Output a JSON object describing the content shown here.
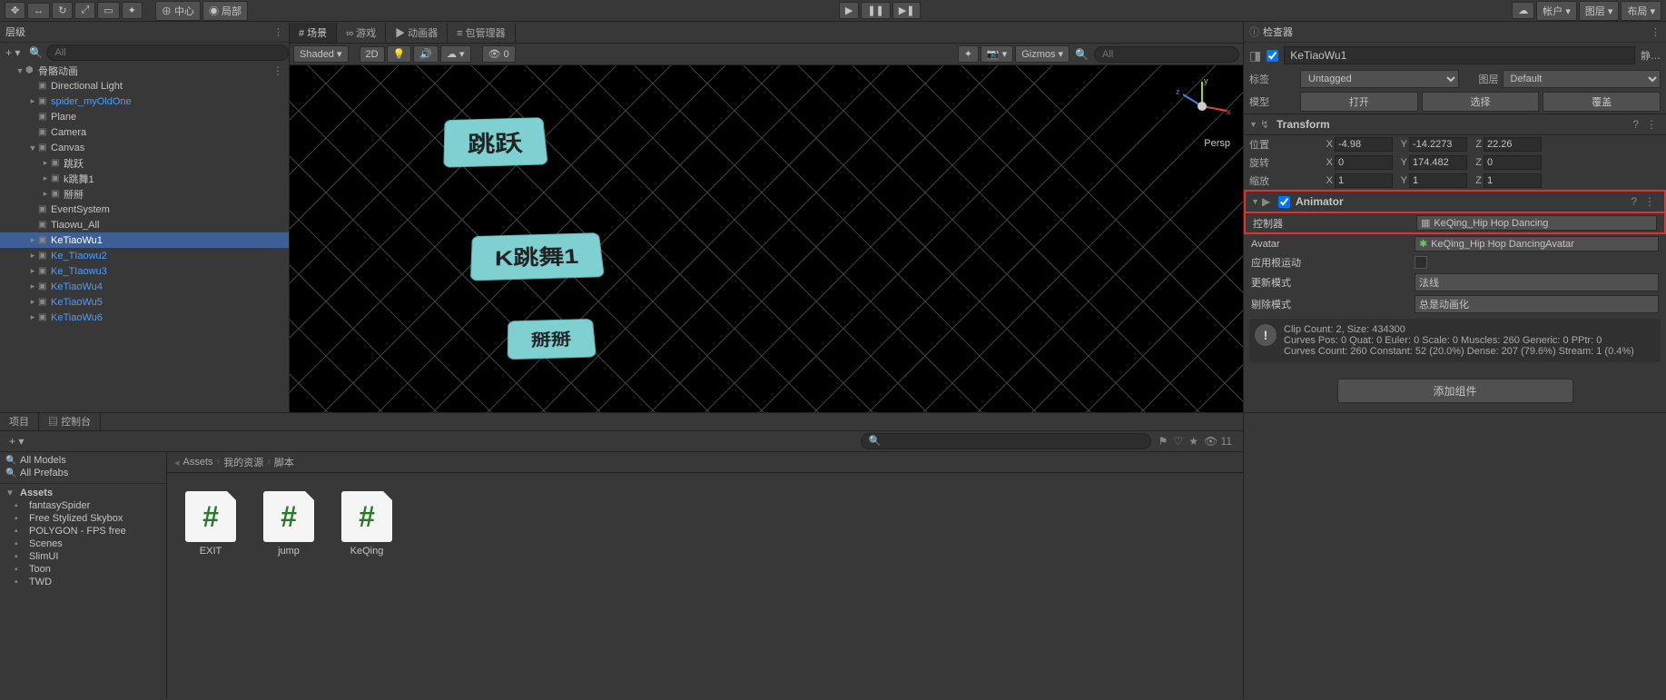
{
  "topbar": {
    "center": "中心",
    "local": "局部",
    "account": "帐户",
    "layers": "图层",
    "layout": "布局"
  },
  "hierarchy": {
    "label": "层级",
    "search_placeholder": "All",
    "root": "骨骼动画",
    "nodes": [
      {
        "name": "Directional Light",
        "blue": false,
        "ind": 2
      },
      {
        "name": "spider_myOldOne",
        "blue": true,
        "ind": 2,
        "arrow": true
      },
      {
        "name": "Plane",
        "blue": false,
        "ind": 2
      },
      {
        "name": "Camera",
        "blue": false,
        "ind": 2
      },
      {
        "name": "Canvas",
        "blue": false,
        "ind": 2,
        "arrow": true,
        "open": true
      },
      {
        "name": "跳跃",
        "blue": false,
        "ind": 3,
        "arrow": true
      },
      {
        "name": "k跳舞1",
        "blue": false,
        "ind": 3,
        "arrow": true
      },
      {
        "name": "掰掰",
        "blue": false,
        "ind": 3,
        "arrow": true
      },
      {
        "name": "EventSystem",
        "blue": false,
        "ind": 2
      },
      {
        "name": "Tiaowu_All",
        "blue": false,
        "ind": 2
      },
      {
        "name": "KeTiaoWu1",
        "blue": true,
        "ind": 2,
        "arrow": true,
        "sel": true
      },
      {
        "name": "Ke_TIaowu2",
        "blue": true,
        "ind": 2,
        "arrow": true
      },
      {
        "name": "Ke_TIaowu3",
        "blue": true,
        "ind": 2,
        "arrow": true
      },
      {
        "name": "KeTiaoWu4",
        "blue": true,
        "ind": 2,
        "arrow": true
      },
      {
        "name": "KeTiaoWu5",
        "blue": true,
        "ind": 2,
        "arrow": true
      },
      {
        "name": "KeTiaoWu6",
        "blue": true,
        "ind": 2,
        "arrow": true
      }
    ]
  },
  "scene": {
    "tabs": [
      "# 场景",
      "∞ 游戏",
      "▶ 动画器",
      "≡ 包管理器"
    ],
    "toolbar": {
      "shaded": "Shaded",
      "twod": "2D",
      "gizmos": "Gizmos",
      "search_placeholder": "All"
    },
    "cards": [
      "跳跃",
      "K跳舞1",
      "掰掰"
    ],
    "persp": "Persp"
  },
  "inspector": {
    "tab": "检查器",
    "object_name": "KeTiaoWu1",
    "static": "静…",
    "tag_label": "标签",
    "tag_value": "Untagged",
    "layer_label": "图层",
    "layer_value": "Default",
    "model_label": "模型",
    "open_btn": "打开",
    "select_btn": "选择",
    "override_btn": "覆盖",
    "transform": {
      "title": "Transform",
      "pos_label": "位置",
      "pos": {
        "x": "-4.98",
        "y": "-14.2273",
        "z": "22.26"
      },
      "rot_label": "旋转",
      "rot": {
        "x": "0",
        "y": "174.482",
        "z": "0"
      },
      "scale_label": "缩放",
      "scale": {
        "x": "1",
        "y": "1",
        "z": "1"
      }
    },
    "animator": {
      "title": "Animator",
      "controller_label": "控制器",
      "controller_value": "KeQing_Hip Hop Dancing",
      "avatar_label": "Avatar",
      "avatar_value": "KeQing_Hip Hop DancingAvatar",
      "root_label": "应用根运动",
      "update_label": "更新模式",
      "update_value": "法线",
      "cull_label": "剔除模式",
      "cull_value": "总是动画化",
      "info1": "Clip Count: 2, Size: 434300",
      "info2": "Curves Pos: 0 Quat: 0 Euler: 0 Scale: 0 Muscles: 260 Generic: 0 PPtr: 0",
      "info3": "Curves Count: 260 Constant: 52 (20.0%) Dense: 207 (79.6%) Stream: 1 (0.4%)"
    },
    "add_component": "添加组件"
  },
  "project": {
    "tab_project": "项目",
    "tab_console": "控制台",
    "hidden_count": "11",
    "favorites": [
      "All Models",
      "All Prefabs"
    ],
    "assets_label": "Assets",
    "folders": [
      "fantasySpider",
      "Free Stylized Skybox",
      "POLYGON - FPS free",
      "Scenes",
      "SlimUI",
      "Toon",
      "TWD"
    ],
    "breadcrumb": [
      "Assets",
      "我的资源",
      "脚本"
    ],
    "files": [
      "EXIT",
      "jump",
      "KeQing"
    ]
  }
}
